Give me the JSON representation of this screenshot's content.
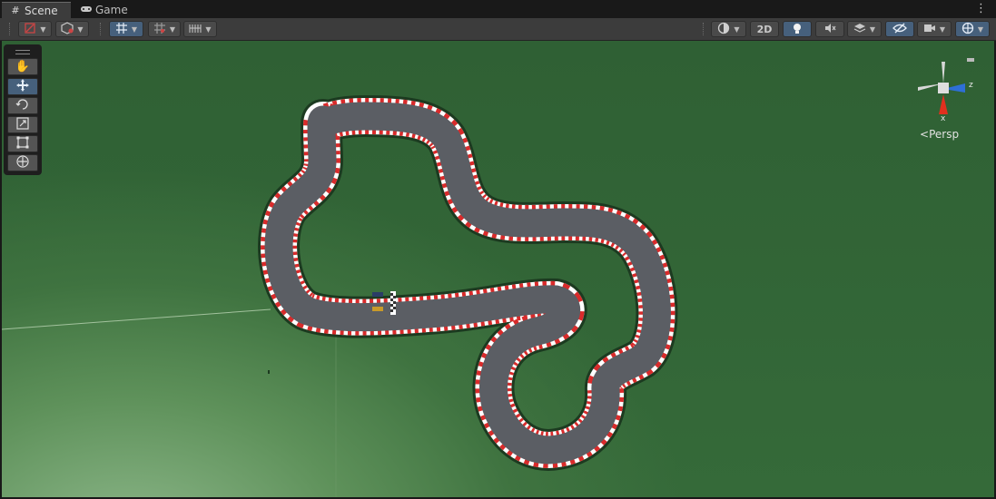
{
  "tabs": [
    {
      "label": "Scene",
      "icon": "grid-icon",
      "active": true
    },
    {
      "label": "Game",
      "icon": "gamepad-icon",
      "active": false
    }
  ],
  "toolbar": {
    "mode_2d_label": "2D",
    "accent_color": "#46607c"
  },
  "tools": [
    {
      "name": "hand-tool",
      "icon": "hand-icon",
      "active": false
    },
    {
      "name": "move-tool",
      "icon": "move-icon",
      "active": true
    },
    {
      "name": "rotate-tool",
      "icon": "rotate-icon",
      "active": false
    },
    {
      "name": "scale-tool",
      "icon": "scale-icon",
      "active": false
    },
    {
      "name": "rect-tool",
      "icon": "rect-icon",
      "active": false
    },
    {
      "name": "transform-tool",
      "icon": "transform-icon",
      "active": false
    }
  ],
  "gizmo": {
    "z_label": "z",
    "x_label": "x",
    "projection_label": "Persp",
    "colors": {
      "x": "#e0301e",
      "z": "#2e6fd6",
      "y": "#cccccc"
    }
  },
  "scene": {
    "ground_color": "#2f6034",
    "track_color": "#5a5d63",
    "curb_colors": [
      "#d92b2b",
      "#ffffff"
    ]
  }
}
